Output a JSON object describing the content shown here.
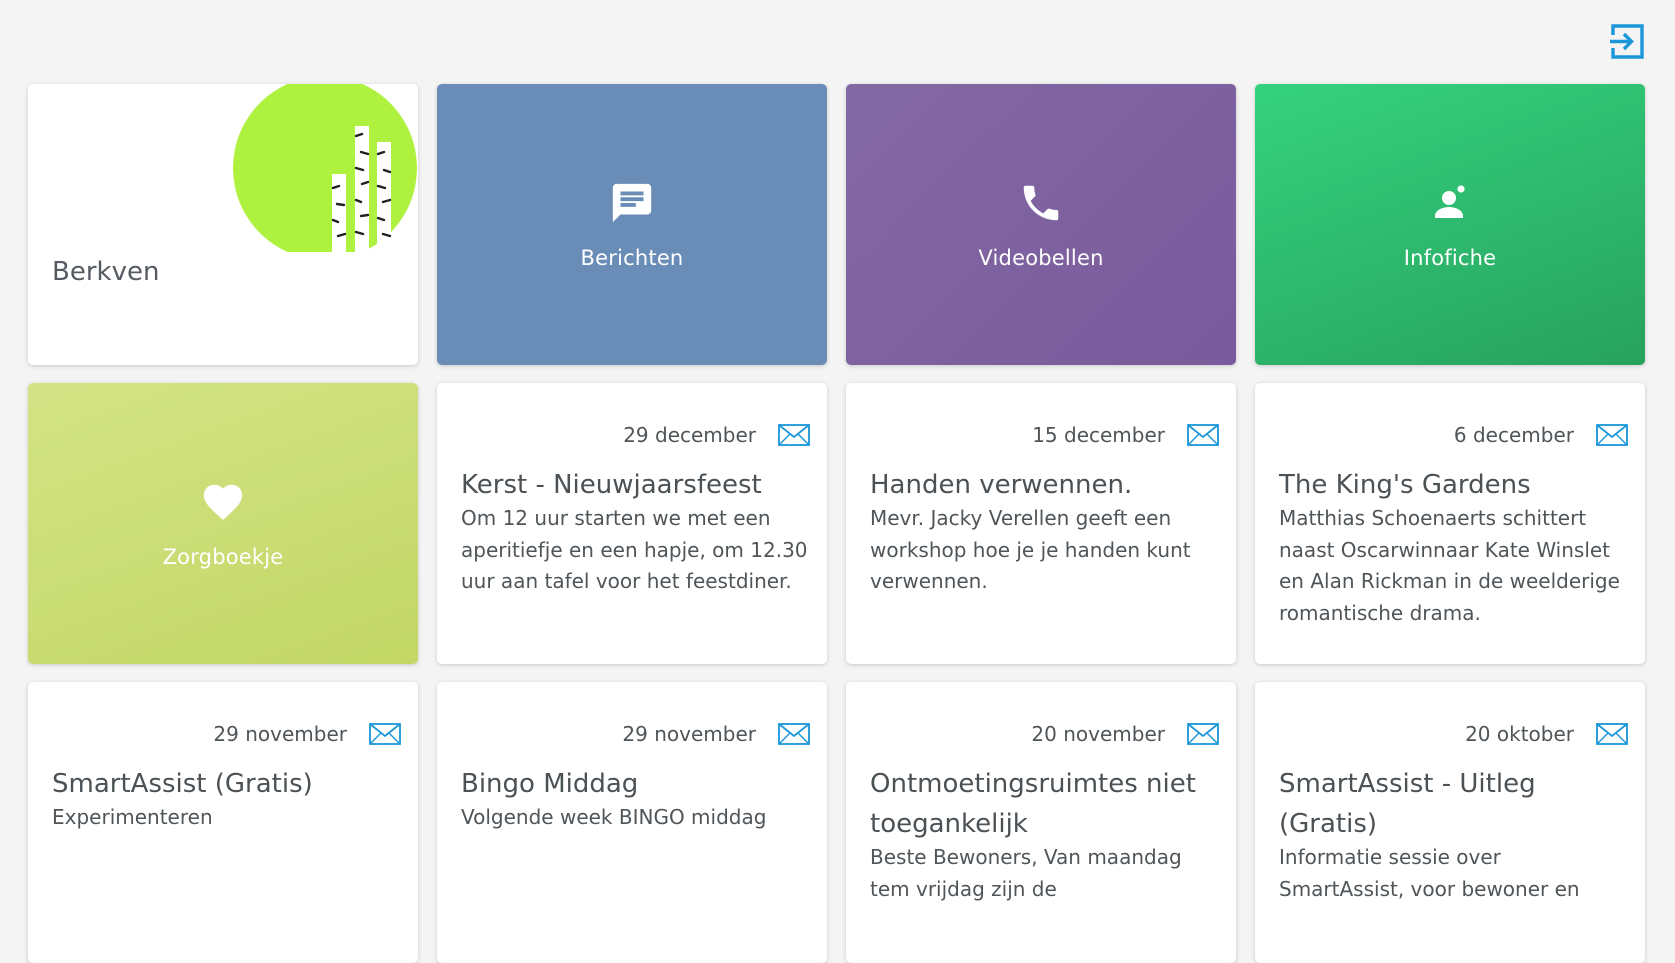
{
  "header": {
    "logout_icon": "logout-icon"
  },
  "brand": {
    "name": "Berkven",
    "logo_color": "#aef23f"
  },
  "actions": [
    {
      "label": "Berichten",
      "icon": "chat-icon",
      "color": "#6a8db8"
    },
    {
      "label": "Videobellen",
      "icon": "phone-icon",
      "color": "#7f62a0"
    },
    {
      "label": "Infofiche",
      "icon": "person-icon",
      "color": "#2ebd6f"
    },
    {
      "label": "Zorgboekje",
      "icon": "heart-icon",
      "color": "#cadd75"
    }
  ],
  "messages": [
    {
      "date": "29 december",
      "title": "Kerst - Nieuwjaarsfeest",
      "body": "Om 12 uur starten we met een aperitiefje en een hapje, om 12.30 uur aan tafel voor het feestdiner."
    },
    {
      "date": "15 december",
      "title": "Handen verwennen.",
      "body": "Mevr. Jacky Verellen geeft een workshop hoe je je handen kunt verwennen."
    },
    {
      "date": "6 december",
      "title": "The King's Gardens",
      "body": "Matthias Schoenaerts schittert naast Oscarwinnaar Kate Winslet en Alan Rickman in de weelderige romantische drama."
    },
    {
      "date": "29 november",
      "title": "SmartAssist (Gratis)",
      "body": "Experimenteren"
    },
    {
      "date": "29 november",
      "title": "Bingo Middag",
      "body": "Volgende week BINGO middag"
    },
    {
      "date": "20 november",
      "title": "Ontmoetingsruimtes niet toegankelijk",
      "body": "Beste Bewoners, Van maandag tem vrijdag zijn de"
    },
    {
      "date": "20 oktober",
      "title": "SmartAssist - Uitleg (Gratis)",
      "body": "Informatie sessie over SmartAssist, voor bewoner en"
    }
  ],
  "mail_icon": "envelope-icon",
  "accent_color": "#1a96d9"
}
